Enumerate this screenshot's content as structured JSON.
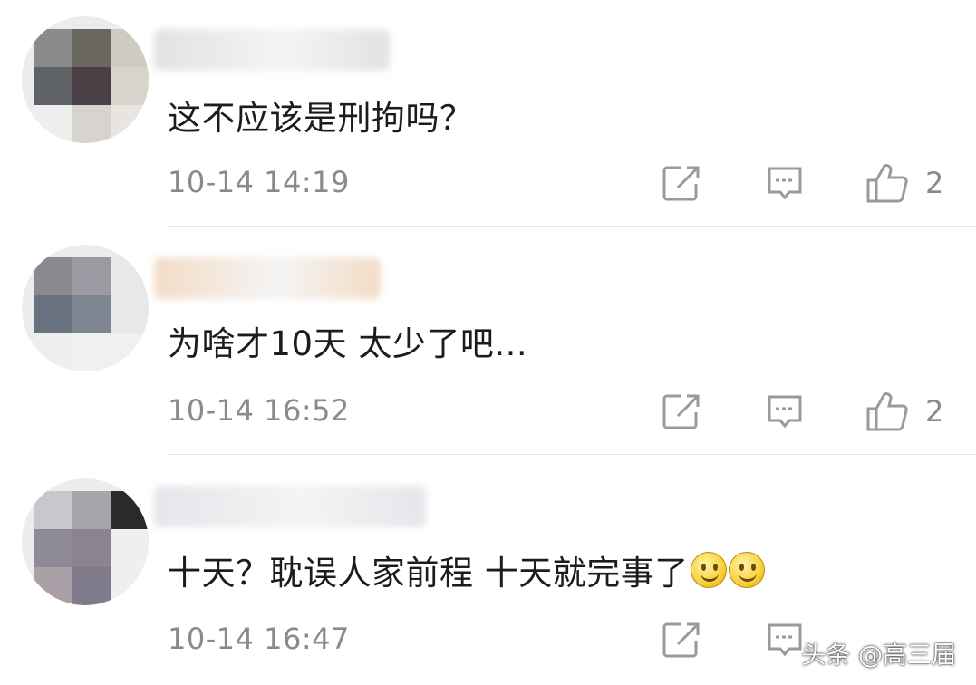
{
  "comments": [
    {
      "text": "这不应该是刑拘吗？",
      "time": "10-14 14:19",
      "likes": "2",
      "emoji_count": 0,
      "avatar_colors": [
        "#8a8a8a",
        "#6b6862",
        "#cfcac2",
        "#5f6368",
        "#4a3f44",
        "#d8d4cc",
        "#eeeeee",
        "#d7d3cf",
        "#e8e5e0"
      ],
      "name_blur_color": "#e2e2e2"
    },
    {
      "text": "为啥才10天 太少了吧...",
      "time": "10-14 16:52",
      "likes": "2",
      "emoji_count": 0,
      "avatar_colors": [
        "#8c8890",
        "#9a9aa2",
        "#e8e8ea",
        "#687280",
        "#7c8590",
        "#e8e8ea",
        "#eeeeee",
        "#f0f0f0",
        "#f0f0f0"
      ],
      "name_blur_color": "#f3dcc6"
    },
    {
      "text": "十天？耽误人家前程 十天就完事了",
      "time": "10-14 16:47",
      "likes": "",
      "emoji_count": 2,
      "avatar_colors": [
        "#c9c6cc",
        "#a8a4ab",
        "#2a2a2a",
        "#8e8a97",
        "#8b8390",
        "#efefef",
        "#a9a0a8",
        "#7f7b8b",
        "#efefef"
      ],
      "name_blur_color": "#e4e6ea"
    }
  ],
  "icons": {
    "share": "share-icon",
    "reply": "comment-icon",
    "like": "thumbs-up-icon"
  },
  "watermark": "头条 @高三届"
}
